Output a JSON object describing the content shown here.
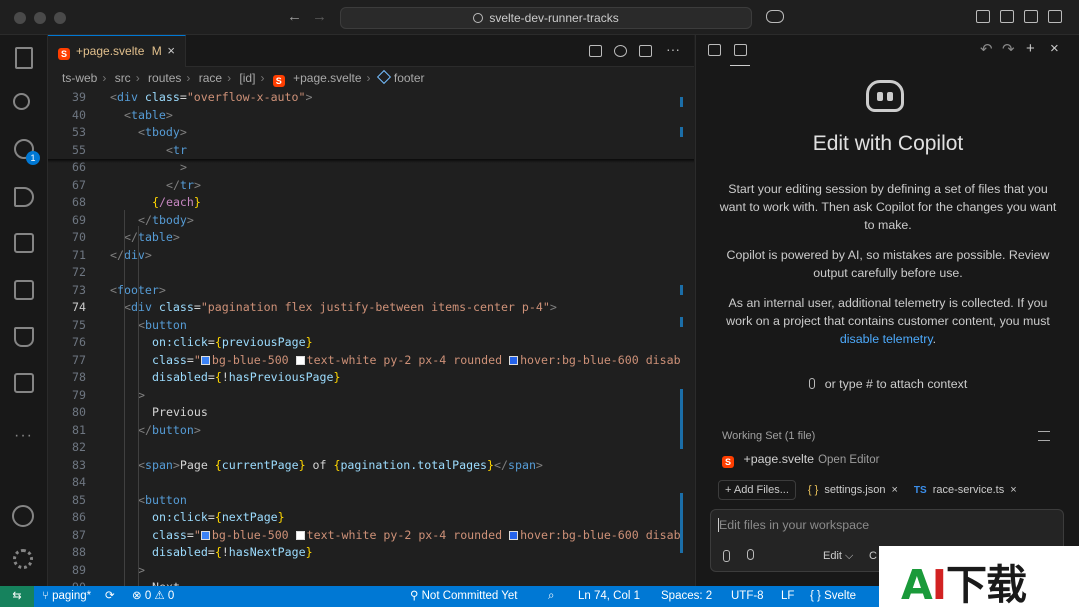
{
  "titlebar": {
    "search_text": "svelte-dev-runner-tracks",
    "nav_back": "←",
    "nav_forward": "→"
  },
  "activity": {
    "source_control_badge": "1"
  },
  "tab": {
    "filename": "+page.svelte",
    "status": "M",
    "close": "×"
  },
  "breadcrumb": [
    "ts-web",
    "src",
    "routes",
    "race",
    "[id]",
    "+page.svelte",
    "footer"
  ],
  "code_lines": [
    {
      "n": "39",
      "html": "<span class='t-punc'>&lt;</span><span class='t-tag'>div</span> <span class='t-attr'>class</span><span class='t-txt'>=</span><span class='t-str'>\"overflow-x-auto\"</span><span class='t-punc'>&gt;</span>",
      "indent": 0
    },
    {
      "n": "40",
      "html": "<span class='t-punc'>&lt;</span><span class='t-tag'>table</span><span class='t-punc'>&gt;</span>",
      "indent": 1
    },
    {
      "n": "53",
      "html": "<span class='t-punc'>&lt;</span><span class='t-tag'>tbody</span><span class='t-punc'>&gt;</span>",
      "indent": 2
    },
    {
      "n": "55",
      "html": "<span class='t-punc'>&lt;</span><span class='t-tag'>tr</span>",
      "indent": 4
    },
    {
      "n": "66",
      "html": "<span class='t-punc'>&gt;</span>",
      "indent": 5
    },
    {
      "n": "67",
      "html": "<span class='t-punc'>&lt;/</span><span class='t-tag'>tr</span><span class='t-punc'>&gt;</span>",
      "indent": 4
    },
    {
      "n": "68",
      "html": "<span class='t-brace'>{</span><span class='t-kw'>/each</span><span class='t-brace'>}</span>",
      "indent": 3
    },
    {
      "n": "69",
      "html": "<span class='t-punc'>&lt;/</span><span class='t-tag'>tbody</span><span class='t-punc'>&gt;</span>",
      "indent": 2
    },
    {
      "n": "70",
      "html": "<span class='t-punc'>&lt;/</span><span class='t-tag'>table</span><span class='t-punc'>&gt;</span>",
      "indent": 1
    },
    {
      "n": "71",
      "html": "<span class='t-punc'>&lt;/</span><span class='t-tag'>div</span><span class='t-punc'>&gt;</span>",
      "indent": 0
    },
    {
      "n": "72",
      "html": "",
      "indent": 0
    },
    {
      "n": "73",
      "html": "<span class='t-punc'>&lt;</span><span class='t-tag'>footer</span><span class='t-punc'>&gt;</span>",
      "indent": 0
    },
    {
      "n": "74",
      "html": "<span class='t-punc'>&lt;</span><span class='t-tag'>div</span> <span class='t-attr'>class</span><span class='t-txt'>=</span><span class='t-str'>\"pagination flex justify-between items-center p-4\"</span><span class='t-punc'>&gt;</span>",
      "indent": 1,
      "current": true
    },
    {
      "n": "75",
      "html": "<span class='t-punc'>&lt;</span><span class='t-tag'>button</span>",
      "indent": 2
    },
    {
      "n": "76",
      "html": "<span class='t-attr'>on:click</span><span class='t-txt'>=</span><span class='t-brace'>{</span><span class='t-var'>previousPage</span><span class='t-brace'>}</span>",
      "indent": 3
    },
    {
      "n": "77",
      "html": "<span class='t-attr'>class</span><span class='t-txt'>=</span><span class='t-str'>\"</span><span class='sw' style='background:#3b82f6'></span><span class='t-str'>bg-blue-500 </span><span class='sw' style='background:#ffffff'></span><span class='t-str'>text-white py-2 px-4 rounded </span><span class='sw' style='background:#2563eb'></span><span class='t-str'>hover:bg-blue-600 disab</span>",
      "indent": 3
    },
    {
      "n": "78",
      "html": "<span class='t-attr'>disabled</span><span class='t-txt'>=</span><span class='t-brace'>{</span><span class='t-txt'>!</span><span class='t-var'>hasPreviousPage</span><span class='t-brace'>}</span>",
      "indent": 3
    },
    {
      "n": "79",
      "html": "<span class='t-punc'>&gt;</span>",
      "indent": 2
    },
    {
      "n": "80",
      "html": "<span class='t-txt'>Previous</span>",
      "indent": 3
    },
    {
      "n": "81",
      "html": "<span class='t-punc'>&lt;/</span><span class='t-tag'>button</span><span class='t-punc'>&gt;</span>",
      "indent": 2
    },
    {
      "n": "82",
      "html": "",
      "indent": 0
    },
    {
      "n": "83",
      "html": "<span class='t-punc'>&lt;</span><span class='t-tag'>span</span><span class='t-punc'>&gt;</span><span class='t-txt'>Page </span><span class='t-brace'>{</span><span class='t-var'>currentPage</span><span class='t-brace'>}</span><span class='t-txt'> of </span><span class='t-brace'>{</span><span class='t-var'>pagination.totalPages</span><span class='t-brace'>}</span><span class='t-punc'>&lt;/</span><span class='t-tag'>span</span><span class='t-punc'>&gt;</span>",
      "indent": 2
    },
    {
      "n": "84",
      "html": "",
      "indent": 0
    },
    {
      "n": "85",
      "html": "<span class='t-punc'>&lt;</span><span class='t-tag'>button</span>",
      "indent": 2
    },
    {
      "n": "86",
      "html": "<span class='t-attr'>on:click</span><span class='t-txt'>=</span><span class='t-brace'>{</span><span class='t-var'>nextPage</span><span class='t-brace'>}</span>",
      "indent": 3
    },
    {
      "n": "87",
      "html": "<span class='t-attr'>class</span><span class='t-txt'>=</span><span class='t-str'>\"</span><span class='sw' style='background:#3b82f6'></span><span class='t-str'>bg-blue-500 </span><span class='sw' style='background:#ffffff'></span><span class='t-str'>text-white py-2 px-4 rounded </span><span class='sw' style='background:#2563eb'></span><span class='t-str'>hover:bg-blue-600 disab</span>",
      "indent": 3
    },
    {
      "n": "88",
      "html": "<span class='t-attr'>disabled</span><span class='t-txt'>=</span><span class='t-brace'>{</span><span class='t-txt'>!</span><span class='t-var'>hasNextPage</span><span class='t-brace'>}</span>",
      "indent": 3
    },
    {
      "n": "89",
      "html": "<span class='t-punc'>&gt;</span>",
      "indent": 2
    },
    {
      "n": "90",
      "html": "<span class='t-txt'>Next</span>",
      "indent": 3
    }
  ],
  "copilot": {
    "title": "Edit with Copilot",
    "intro": "Start your editing session by defining a set of files that you want to work with. Then ask Copilot for the changes you want to make.",
    "disclaimer": "Copilot is powered by AI, so mistakes are possible. Review output carefully before use.",
    "telemetry_prefix": "As an internal user, additional telemetry is collected. If you work on a project that contains customer content, you must ",
    "telemetry_link": "disable telemetry",
    "telemetry_suffix": ".",
    "attach_hint": "or type # to attach context",
    "working_set_header": "Working Set (1 file)",
    "working_file": "+page.svelte",
    "working_file_desc": "Open Editor",
    "add_files": "+ Add Files...",
    "chip_json": "settings.json",
    "chip_ts": "race-service.ts",
    "chip_ts_badge": "TS",
    "chip_json_badge": "{ }",
    "chip_close": "×",
    "input_placeholder": "Edit files in your workspace",
    "mode_label": "Edit ⌵",
    "model_label": "C"
  },
  "status": {
    "branch": "paging*",
    "sync_icon": "⟳",
    "problems": "⊗ 0 ⚠ 0",
    "git_blame": "Not Committed Yet",
    "position": "Ln 74, Col 1",
    "spaces": "Spaces: 2",
    "encoding": "UTF-8",
    "eol": "LF",
    "language": "{ } Svelte",
    "remote": "⇆"
  },
  "watermark": {
    "a": "A",
    "i": "I",
    "rest": "下载"
  },
  "colors": {
    "accent": "#0078d4",
    "svelte": "#ff3e00",
    "modified": "#e2c08d"
  }
}
